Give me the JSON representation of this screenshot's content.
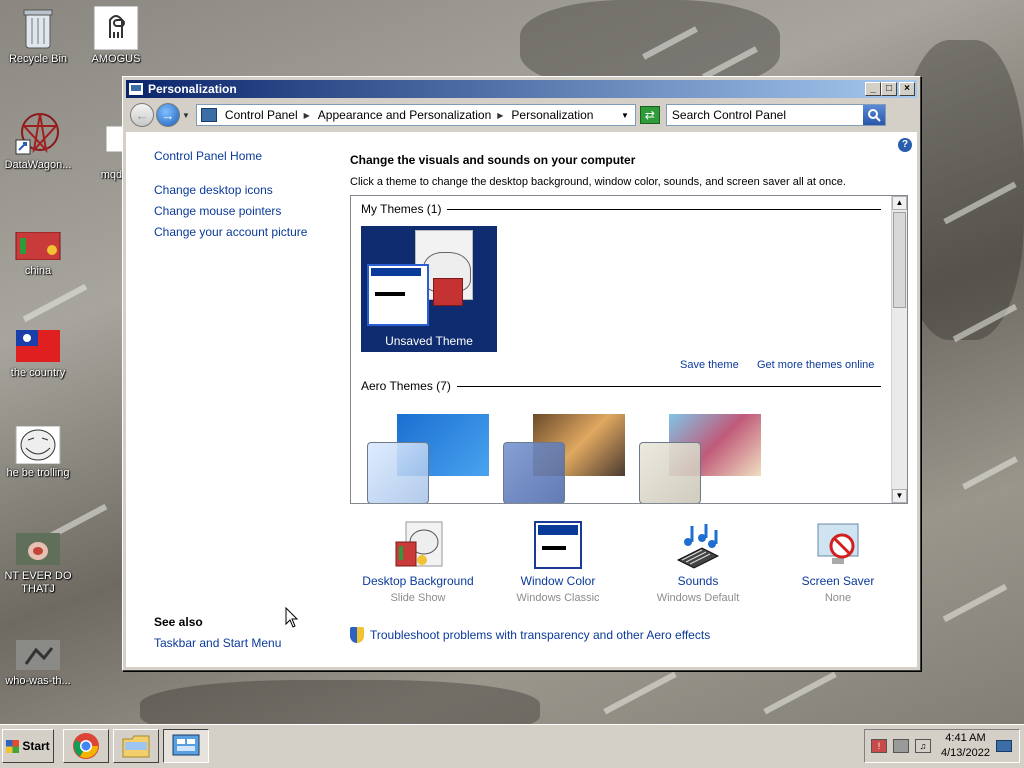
{
  "desktop": {
    "icons": [
      {
        "label": "Recycle Bin"
      },
      {
        "label": "AMOGUS"
      },
      {
        "label": "DataWagon..."
      },
      {
        "label": "mqdef"
      },
      {
        "label": "china"
      },
      {
        "label": "the country"
      },
      {
        "label": "he be trolling"
      },
      {
        "label": "NT EVER DO THATJ"
      },
      {
        "label": "who-was-th..."
      }
    ]
  },
  "window": {
    "title": "Personalization",
    "controls": {
      "minimize": "_",
      "maximize": "□",
      "close": "×"
    }
  },
  "address": {
    "crumbs": [
      "Control Panel",
      "Appearance and Personalization",
      "Personalization"
    ],
    "search_placeholder": "Search Control Panel"
  },
  "sidebar": {
    "home": "Control Panel Home",
    "links": [
      "Change desktop icons",
      "Change mouse pointers",
      "Change your account picture"
    ],
    "see_also_title": "See also",
    "see_also_links": [
      "Taskbar and Start Menu"
    ]
  },
  "main": {
    "title": "Change the visuals and sounds on your computer",
    "description": "Click a theme to change the desktop background, window color, sounds, and screen saver all at once.",
    "my_themes_heading": "My Themes (1)",
    "unsaved_theme": "Unsaved Theme",
    "save_theme": "Save theme",
    "get_more_themes": "Get more themes online",
    "aero_themes_heading": "Aero Themes (7)"
  },
  "options": [
    {
      "name": "Desktop Background",
      "value": "Slide Show"
    },
    {
      "name": "Window Color",
      "value": "Windows Classic"
    },
    {
      "name": "Sounds",
      "value": "Windows Default"
    },
    {
      "name": "Screen Saver",
      "value": "None"
    }
  ],
  "troubleshoot_link": "Troubleshoot problems with transparency and other Aero effects",
  "taskbar": {
    "start_label": "Start",
    "time": "4:41 AM",
    "date": "4/13/2022"
  },
  "colors": {
    "link": "#0a3a9a",
    "title_bar_start": "#0a246a",
    "title_bar_end": "#a6caf0",
    "theme_tile_bg": "#0e2c6f"
  }
}
